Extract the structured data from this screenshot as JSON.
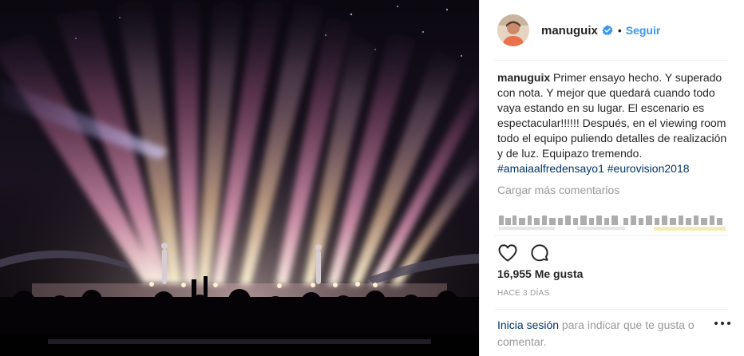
{
  "post": {
    "photo_alt": "",
    "author": {
      "username": "manuguix",
      "verified": true,
      "separator": "•",
      "follow_label": "Seguir"
    },
    "caption": {
      "username": "manuguix",
      "text": "Primer ensayo hecho. Y superado con nota. Y mejor que quedará cuando todo vaya estando en su lugar. El escenario es espectacular!!!!!! Después, en el viewing room todo el equipo puliendo detalles de realización y de luz. Equipazo tremendo.",
      "hashtags": [
        "#amaiaalfredensayo1",
        "#eurovision2018"
      ]
    },
    "load_more_label": "Cargar más comentarios",
    "likes_label": "16,955 Me gusta",
    "timestamp": "HACE 3 DÍAS",
    "login_prompt": {
      "link": "Inicia sesión",
      "rest": " para indicar que te gusta o comentar."
    },
    "icons": {
      "like": "heart-icon",
      "comment": "comment-icon",
      "more": "more-options-icon",
      "verified": "verified-badge-icon"
    },
    "colors": {
      "link_blue": "#3897f0",
      "hashtag": "#003569",
      "muted": "#999999",
      "text": "#262626",
      "verified": "#3897f0"
    }
  }
}
